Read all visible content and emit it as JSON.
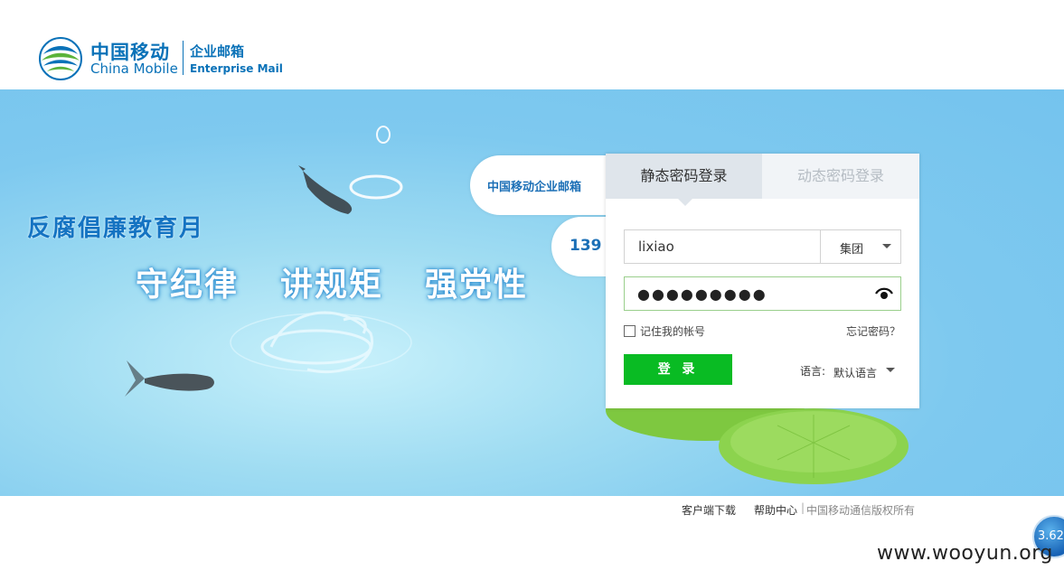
{
  "header": {
    "logo_cn": "中国移动",
    "logo_en": "China Mobile",
    "product_cn": "企业邮箱",
    "product_en": "Enterprise Mail"
  },
  "banner": {
    "slogan_main": "反腐倡廉教育月",
    "slogan_sub": [
      "守纪律",
      "讲规矩",
      "强党性"
    ]
  },
  "side_tabs": {
    "enterprise_mail": "中国移动企业邮箱",
    "mail_139": "139"
  },
  "login": {
    "tabs": [
      {
        "label": "静态密码登录",
        "active": true
      },
      {
        "label": "动态密码登录",
        "active": false
      }
    ],
    "username": "lixiao",
    "domain": "集团",
    "password_mask": "●●●●●●●●●",
    "remember_label": "记住我的帐号",
    "remember_checked": false,
    "forgot_label": "忘记密码？",
    "login_button": "登 录",
    "language_label": "语言:",
    "language_value": "默认语言"
  },
  "footer": {
    "client_download": "客户端下载",
    "help_center": "帮助中心",
    "separator": "|",
    "copyright": "中国移动通信版权所有"
  },
  "overlays": {
    "version_badge": "3.62",
    "watermark": "www.wooyun.org"
  },
  "colors": {
    "brand_blue": "#0a72b8",
    "login_green": "#09bb23",
    "banner_blue": "#7ec9ef"
  }
}
